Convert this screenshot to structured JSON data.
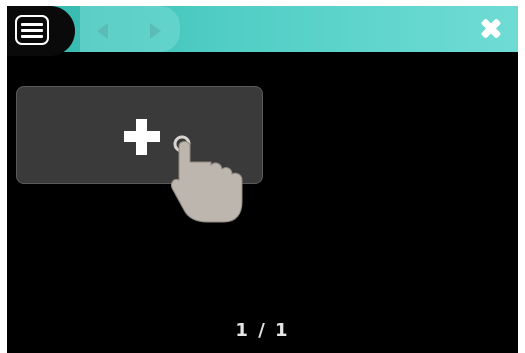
{
  "toolbar": {
    "menu_icon": "menu-icon",
    "prev_icon": "arrow-left-icon",
    "next_icon": "arrow-right-icon",
    "close_icon": "close-icon",
    "accent_color": "#4fcdc4"
  },
  "main": {
    "add_tile_icon": "plus-icon",
    "pointer_icon": "hand-pointer-icon"
  },
  "footer": {
    "page_indicator": "1 / 1"
  }
}
